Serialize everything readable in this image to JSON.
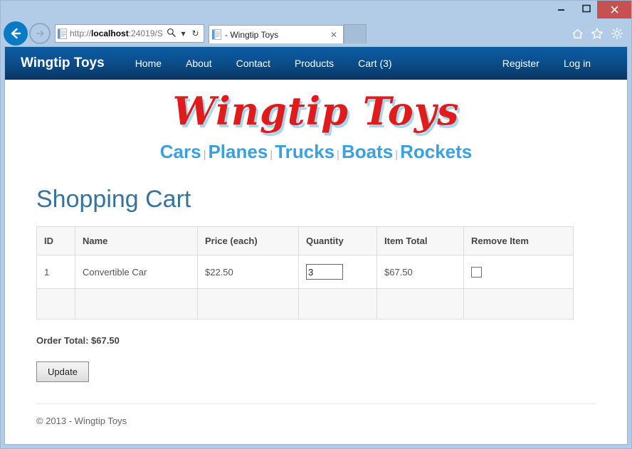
{
  "window": {
    "minimize_label": "minimize",
    "maximize_label": "maximize",
    "close_label": "✕"
  },
  "browser": {
    "back_label": "back",
    "forward_label": "forward",
    "address": {
      "scheme": "http://",
      "host": "localhost",
      "rest": ":24019/S",
      "search_icon": "search-icon",
      "dropdown_icon": "▾",
      "refresh_icon": "↻"
    },
    "tab": {
      "title": "- Wingtip Toys",
      "close_label": "✕"
    },
    "new_tab_label": "",
    "right_icons": [
      "home-icon",
      "favorites-star-icon",
      "settings-gear-icon"
    ]
  },
  "site_nav": {
    "brand": "Wingtip Toys",
    "links": [
      {
        "label": "Home"
      },
      {
        "label": "About"
      },
      {
        "label": "Contact"
      },
      {
        "label": "Products"
      },
      {
        "label": "Cart (3)"
      }
    ],
    "right_links": [
      {
        "label": "Register"
      },
      {
        "label": "Log in"
      }
    ]
  },
  "logo": {
    "text": "Wingtip Toys",
    "color": "#e01b1b",
    "shadow_color": "#a8d6ef"
  },
  "categories": {
    "separator": "|",
    "color": "#3aa0e0",
    "items": [
      {
        "label": "Cars"
      },
      {
        "label": "Planes"
      },
      {
        "label": "Trucks"
      },
      {
        "label": "Boats"
      },
      {
        "label": "Rockets"
      }
    ]
  },
  "page": {
    "title": "Shopping Cart",
    "title_color": "#35749e"
  },
  "cart": {
    "columns": [
      "ID",
      "Name",
      "Price (each)",
      "Quantity",
      "Item Total",
      "Remove Item"
    ],
    "rows": [
      {
        "id": "1",
        "name": "Convertible Car",
        "price": "$22.50",
        "quantity": "3",
        "item_total": "$67.50",
        "remove_checked": false
      }
    ],
    "order_total_label": "Order Total: $67.50",
    "update_button_label": "Update"
  },
  "footer": {
    "text": "© 2013 - Wingtip Toys"
  }
}
